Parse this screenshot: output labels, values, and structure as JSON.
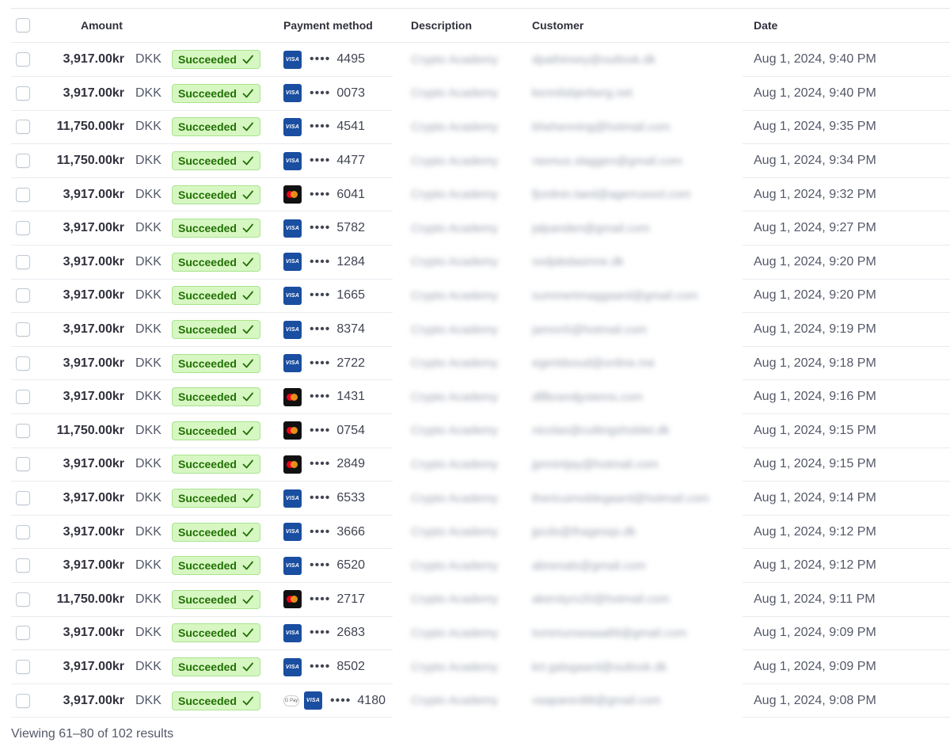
{
  "header": {
    "amount": "Amount",
    "payment_method": "Payment method",
    "description": "Description",
    "customer": "Customer",
    "date": "Date"
  },
  "colors": {
    "badge_bg": "#d7f7c2",
    "badge_text": "#217005",
    "visa": "#1a4ea0"
  },
  "rows": [
    {
      "amount": "3,917.00kr",
      "currency": "DKK",
      "status": "Succeeded",
      "card": "visa",
      "wallet": "",
      "last4": "4495",
      "description": "Crypto Academy",
      "customer": "dpathinsey@outlook.dk",
      "date": "Aug 1, 2024, 9:40 PM"
    },
    {
      "amount": "3,917.00kr",
      "currency": "DKK",
      "status": "Succeeded",
      "card": "visa",
      "wallet": "",
      "last4": "0073",
      "description": "Crypto Academy",
      "customer": "kennilsbjerberg.net",
      "date": "Aug 1, 2024, 9:40 PM"
    },
    {
      "amount": "11,750.00kr",
      "currency": "DKK",
      "status": "Succeeded",
      "card": "visa",
      "wallet": "",
      "last4": "4541",
      "description": "Crypto Academy",
      "customer": "bhehenning@hotmail.com",
      "date": "Aug 1, 2024, 9:35 PM"
    },
    {
      "amount": "11,750.00kr",
      "currency": "DKK",
      "status": "Succeeded",
      "card": "visa",
      "wallet": "",
      "last4": "4477",
      "description": "Crypto Academy",
      "customer": "rasmus.slaggen@gmail.com",
      "date": "Aug 1, 2024, 9:34 PM"
    },
    {
      "amount": "3,917.00kr",
      "currency": "DKK",
      "status": "Succeeded",
      "card": "mastercard",
      "wallet": "",
      "last4": "6041",
      "description": "Crypto Academy",
      "customer": "fjordnin.laed@agerrusool.com",
      "date": "Aug 1, 2024, 9:32 PM"
    },
    {
      "amount": "3,917.00kr",
      "currency": "DKK",
      "status": "Succeeded",
      "card": "visa",
      "wallet": "",
      "last4": "5782",
      "description": "Crypto Academy",
      "customer": "jalpanden@gmail.com",
      "date": "Aug 1, 2024, 9:27 PM"
    },
    {
      "amount": "3,917.00kr",
      "currency": "DKK",
      "status": "Succeeded",
      "card": "visa",
      "wallet": "",
      "last4": "1284",
      "description": "Crypto Academy",
      "customer": "ssdjabdasinne.dk",
      "date": "Aug 1, 2024, 9:20 PM"
    },
    {
      "amount": "3,917.00kr",
      "currency": "DKK",
      "status": "Succeeded",
      "card": "visa",
      "wallet": "",
      "last4": "1665",
      "description": "Crypto Academy",
      "customer": "summertmaggaard@gmail.com",
      "date": "Aug 1, 2024, 9:20 PM"
    },
    {
      "amount": "3,917.00kr",
      "currency": "DKK",
      "status": "Succeeded",
      "card": "visa",
      "wallet": "",
      "last4": "8374",
      "description": "Crypto Academy",
      "customer": "jamon5@hotmail.com",
      "date": "Aug 1, 2024, 9:19 PM"
    },
    {
      "amount": "3,917.00kr",
      "currency": "DKK",
      "status": "Succeeded",
      "card": "visa",
      "wallet": "",
      "last4": "2722",
      "description": "Crypto Academy",
      "customer": "egertdsoud@online.me",
      "date": "Aug 1, 2024, 9:18 PM"
    },
    {
      "amount": "3,917.00kr",
      "currency": "DKK",
      "status": "Succeeded",
      "card": "mastercard",
      "wallet": "",
      "last4": "1431",
      "description": "Crypto Academy",
      "customer": "dlllbrandjystems.com",
      "date": "Aug 1, 2024, 9:16 PM"
    },
    {
      "amount": "11,750.00kr",
      "currency": "DKK",
      "status": "Succeeded",
      "card": "mastercard",
      "wallet": "",
      "last4": "0754",
      "description": "Crypto Academy",
      "customer": "nicolas@cultingsholdet.dk",
      "date": "Aug 1, 2024, 9:15 PM"
    },
    {
      "amount": "3,917.00kr",
      "currency": "DKK",
      "status": "Succeeded",
      "card": "mastercard",
      "wallet": "",
      "last4": "2849",
      "description": "Crypto Academy",
      "customer": "jpnnintjay@hotmail.com",
      "date": "Aug 1, 2024, 9:15 PM"
    },
    {
      "amount": "3,917.00kr",
      "currency": "DKK",
      "status": "Succeeded",
      "card": "visa",
      "wallet": "",
      "last4": "6533",
      "description": "Crypto Academy",
      "customer": "thericuimoldegaard@hotmail.com",
      "date": "Aug 1, 2024, 9:14 PM"
    },
    {
      "amount": "3,917.00kr",
      "currency": "DKK",
      "status": "Succeeded",
      "card": "visa",
      "wallet": "",
      "last4": "3666",
      "description": "Crypto Academy",
      "customer": "jpcds@thagesqs.dk",
      "date": "Aug 1, 2024, 9:12 PM"
    },
    {
      "amount": "3,917.00kr",
      "currency": "DKK",
      "status": "Succeeded",
      "card": "visa",
      "wallet": "",
      "last4": "6520",
      "description": "Crypto Academy",
      "customer": "abnesals@gmail.com",
      "date": "Aug 1, 2024, 9:12 PM"
    },
    {
      "amount": "11,750.00kr",
      "currency": "DKK",
      "status": "Succeeded",
      "card": "mastercard",
      "wallet": "",
      "last4": "2717",
      "description": "Crypto Academy",
      "customer": "akerstyrx20@hotmail.com",
      "date": "Aug 1, 2024, 9:11 PM"
    },
    {
      "amount": "3,917.00kr",
      "currency": "DKK",
      "status": "Succeeded",
      "card": "visa",
      "wallet": "",
      "last4": "2683",
      "description": "Crypto Academy",
      "customer": "tommunseaaa89@gmail.com",
      "date": "Aug 1, 2024, 9:09 PM"
    },
    {
      "amount": "3,917.00kr",
      "currency": "DKK",
      "status": "Succeeded",
      "card": "visa",
      "wallet": "",
      "last4": "8502",
      "description": "Crypto Academy",
      "customer": "krt.galsgaard@outlook.dk",
      "date": "Aug 1, 2024, 9:09 PM"
    },
    {
      "amount": "3,917.00kr",
      "currency": "DKK",
      "status": "Succeeded",
      "card": "visa",
      "wallet": "G Pay",
      "last4": "4180",
      "description": "Crypto Academy",
      "customer": "vaaparen88@gmail.com",
      "date": "Aug 1, 2024, 9:08 PM"
    }
  ],
  "footer": {
    "results_text": "Viewing 61–80 of 102 results"
  }
}
